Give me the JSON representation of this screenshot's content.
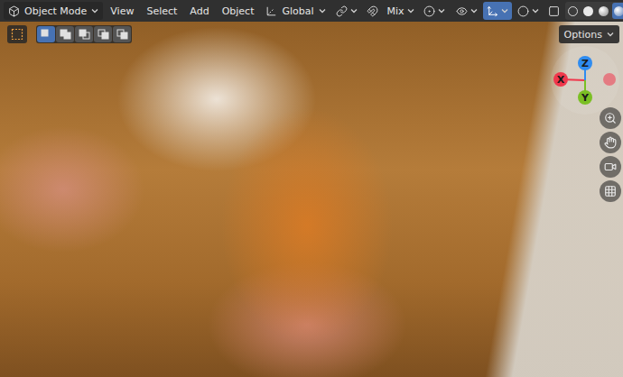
{
  "header": {
    "mode": {
      "label": "Object Mode"
    },
    "menus": [
      "View",
      "Select",
      "Add",
      "Object"
    ],
    "orientation": {
      "label": "Global"
    },
    "tools": [
      {
        "kind": "pivot",
        "active": false,
        "menu": true
      },
      {
        "kind": "snap",
        "active": false,
        "menu": false
      },
      {
        "kind": "snap-target",
        "label": "Mix",
        "active": false,
        "menu": true
      },
      {
        "kind": "proportional",
        "active": false,
        "menu": true
      }
    ],
    "view_tools": [
      {
        "kind": "visibility",
        "active": false,
        "menu": true
      },
      {
        "kind": "gizmo",
        "active": true,
        "menu": true
      },
      {
        "kind": "overlay",
        "active": false,
        "menu": true
      },
      {
        "kind": "xray",
        "active": false,
        "menu": false
      }
    ],
    "shading": {
      "modes": [
        {
          "kind": "wireframe",
          "selected": false
        },
        {
          "kind": "solid",
          "selected": false
        },
        {
          "kind": "material",
          "selected": false
        },
        {
          "kind": "rendered",
          "selected": true
        }
      ],
      "menu": true
    }
  },
  "tool_row": {
    "tool": {
      "kind": "select-box",
      "active": true
    },
    "select_modes": [
      {
        "kind": "set",
        "selected": true
      },
      {
        "kind": "extend",
        "selected": false
      },
      {
        "kind": "subtract",
        "selected": false
      },
      {
        "kind": "difference",
        "selected": false
      },
      {
        "kind": "intersect",
        "selected": false
      }
    ],
    "options": {
      "label": "Options"
    }
  },
  "gizmo": {
    "axes": [
      {
        "label": "X",
        "color": "#f0374c"
      },
      {
        "label": "Y",
        "color": "#7bbf24"
      },
      {
        "label": "Z",
        "color": "#2f8cf0"
      }
    ]
  }
}
